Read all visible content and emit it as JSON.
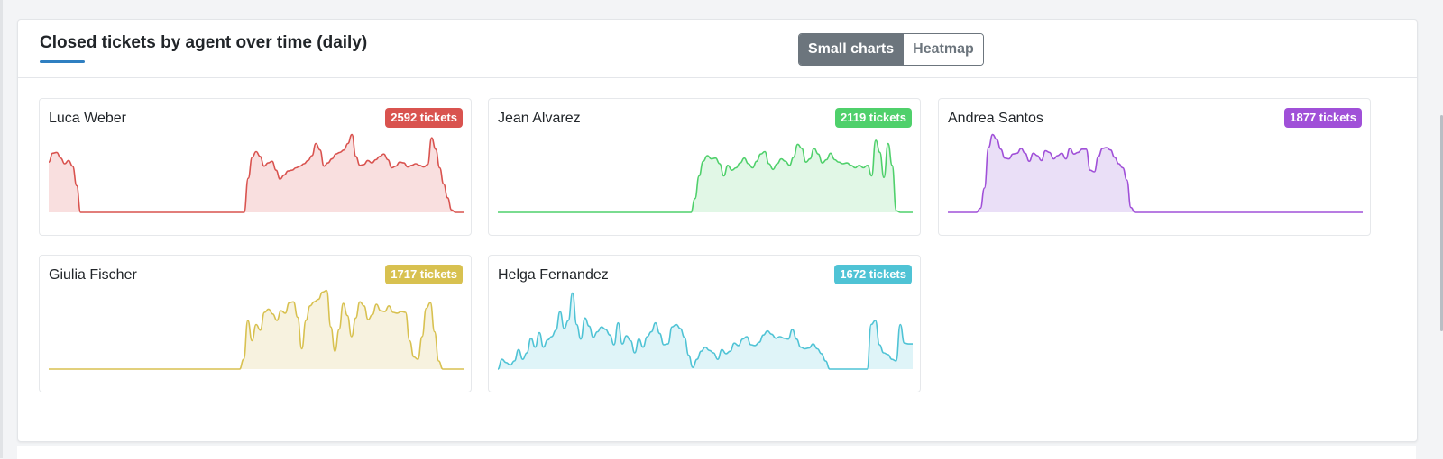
{
  "panel": {
    "title": "Closed tickets by agent over time (daily)"
  },
  "view_toggle": {
    "small_charts_label": "Small charts",
    "heatmap_label": "Heatmap",
    "selected": "Small charts"
  },
  "agents": [
    {
      "name": "Luca Weber",
      "badge": "2592 tickets",
      "color": "#d9534f",
      "fill": "#f9dfdf",
      "series": [
        0.62,
        0.73,
        0.74,
        0.67,
        0.6,
        0.64,
        0.57,
        0.33,
        0,
        0,
        0,
        0,
        0,
        0,
        0,
        0,
        0,
        0,
        0,
        0,
        0,
        0,
        0,
        0,
        0,
        0,
        0,
        0,
        0,
        0,
        0,
        0,
        0,
        0,
        0,
        0,
        0,
        0,
        0,
        0,
        0,
        0,
        0,
        0,
        0,
        0,
        0,
        0,
        0,
        0,
        0.42,
        0.68,
        0.75,
        0.69,
        0.57,
        0.61,
        0.63,
        0.52,
        0.41,
        0.46,
        0.51,
        0.52,
        0.55,
        0.57,
        0.6,
        0.64,
        0.7,
        0.85,
        0.77,
        0.57,
        0.61,
        0.66,
        0.72,
        0.74,
        0.77,
        0.85,
        0.96,
        0.69,
        0.58,
        0.59,
        0.64,
        0.61,
        0.65,
        0.69,
        0.72,
        0.65,
        0.55,
        0.57,
        0.62,
        0.61,
        0.56,
        0.58,
        0.6,
        0.58,
        0.56,
        0.59,
        0.92,
        0.78,
        0.55,
        0.35,
        0.18,
        0.03,
        0,
        0,
        0
      ]
    },
    {
      "name": "Jean Alvarez",
      "badge": "2119 tickets",
      "color": "#4fd06b",
      "fill": "#e1f7e6",
      "series": [
        0,
        0,
        0,
        0,
        0,
        0,
        0,
        0,
        0,
        0,
        0,
        0,
        0,
        0,
        0,
        0,
        0,
        0,
        0,
        0,
        0,
        0,
        0,
        0,
        0,
        0,
        0,
        0,
        0,
        0,
        0,
        0,
        0,
        0,
        0,
        0,
        0,
        0,
        0,
        0,
        0,
        0,
        0,
        0,
        0,
        0,
        0,
        0,
        0.17,
        0.45,
        0.63,
        0.7,
        0.66,
        0.67,
        0.6,
        0.45,
        0.58,
        0.52,
        0.55,
        0.61,
        0.67,
        0.6,
        0.55,
        0.63,
        0.72,
        0.75,
        0.6,
        0.53,
        0.6,
        0.66,
        0.63,
        0.58,
        0.68,
        0.84,
        0.79,
        0.62,
        0.66,
        0.79,
        0.72,
        0.61,
        0.65,
        0.73,
        0.65,
        0.62,
        0.6,
        0.61,
        0.58,
        0.55,
        0.58,
        0.55,
        0.58,
        0.45,
        0.89,
        0.74,
        0.43,
        0.85,
        0.58,
        0.02,
        0,
        0,
        0,
        0
      ]
    },
    {
      "name": "Andrea Santos",
      "badge": "1877 tickets",
      "color": "#a050d8",
      "fill": "#eadff7",
      "series": [
        0,
        0,
        0,
        0,
        0,
        0,
        0,
        0,
        0.05,
        0.3,
        0.8,
        0.96,
        0.9,
        0.78,
        0.67,
        0.66,
        0.72,
        0.73,
        0.79,
        0.73,
        0.63,
        0.73,
        0.7,
        0.64,
        0.76,
        0.74,
        0.66,
        0.7,
        0.73,
        0.66,
        0.79,
        0.72,
        0.74,
        0.78,
        0.78,
        0.52,
        0.5,
        0.69,
        0.79,
        0.8,
        0.77,
        0.68,
        0.6,
        0.55,
        0.4,
        0.06,
        0,
        0,
        0,
        0,
        0,
        0,
        0,
        0,
        0,
        0,
        0,
        0,
        0,
        0,
        0,
        0,
        0,
        0,
        0,
        0,
        0,
        0,
        0,
        0,
        0,
        0,
        0,
        0,
        0,
        0,
        0,
        0,
        0,
        0,
        0,
        0,
        0,
        0,
        0,
        0,
        0,
        0,
        0,
        0,
        0,
        0,
        0,
        0,
        0,
        0,
        0,
        0,
        0,
        0,
        0,
        0,
        0
      ]
    },
    {
      "name": "Giulia Fischer",
      "badge": "1717 tickets",
      "color": "#d8c150",
      "fill": "#f7f2df",
      "series": [
        0,
        0,
        0,
        0,
        0,
        0,
        0,
        0,
        0,
        0,
        0,
        0,
        0,
        0,
        0,
        0,
        0,
        0,
        0,
        0,
        0,
        0,
        0,
        0,
        0,
        0,
        0,
        0,
        0,
        0,
        0,
        0,
        0,
        0,
        0,
        0,
        0,
        0,
        0,
        0,
        0,
        0,
        0,
        0,
        0,
        0,
        0,
        0.12,
        0.6,
        0.35,
        0.55,
        0.48,
        0.7,
        0.74,
        0.68,
        0.6,
        0.72,
        0.69,
        0.82,
        0.83,
        0.64,
        0.25,
        0.6,
        0.78,
        0.83,
        0.86,
        0.95,
        0.97,
        0.52,
        0.22,
        0.49,
        0.81,
        0.66,
        0.4,
        0.63,
        0.83,
        0.78,
        0.61,
        0.67,
        0.8,
        0.72,
        0.71,
        0.78,
        0.7,
        0.69,
        0.71,
        0.7,
        0.35,
        0.15,
        0.12,
        0.4,
        0.75,
        0.82,
        0.46,
        0.1,
        0,
        0,
        0,
        0,
        0,
        0
      ]
    },
    {
      "name": "Helga Fernandez",
      "badge": "1672 tickets",
      "color": "#4fc3d5",
      "fill": "#dff4f8",
      "series": [
        0,
        0.12,
        0.08,
        0.05,
        0.1,
        0.24,
        0.12,
        0.2,
        0.38,
        0.27,
        0.45,
        0.27,
        0.36,
        0.4,
        0.48,
        0.71,
        0.5,
        0.6,
        0.94,
        0.55,
        0.37,
        0.63,
        0.53,
        0.39,
        0.46,
        0.52,
        0.49,
        0.42,
        0.3,
        0.57,
        0.31,
        0.41,
        0.35,
        0.2,
        0.37,
        0.27,
        0.4,
        0.46,
        0.57,
        0.44,
        0.3,
        0.31,
        0.52,
        0.55,
        0.5,
        0.39,
        0.17,
        0.02,
        0.12,
        0.22,
        0.27,
        0.23,
        0.2,
        0.12,
        0.24,
        0.19,
        0.22,
        0.32,
        0.29,
        0.37,
        0.4,
        0.3,
        0.29,
        0.33,
        0.42,
        0.47,
        0.43,
        0.38,
        0.4,
        0.38,
        0.37,
        0.49,
        0.37,
        0.27,
        0.25,
        0.26,
        0.31,
        0.25,
        0.19,
        0.1,
        0,
        0,
        0,
        0,
        0,
        0,
        0,
        0,
        0,
        0,
        0.55,
        0.6,
        0.3,
        0.2,
        0.18,
        0.12,
        0.1,
        0.55,
        0.32,
        0.31,
        0.31
      ]
    }
  ]
}
